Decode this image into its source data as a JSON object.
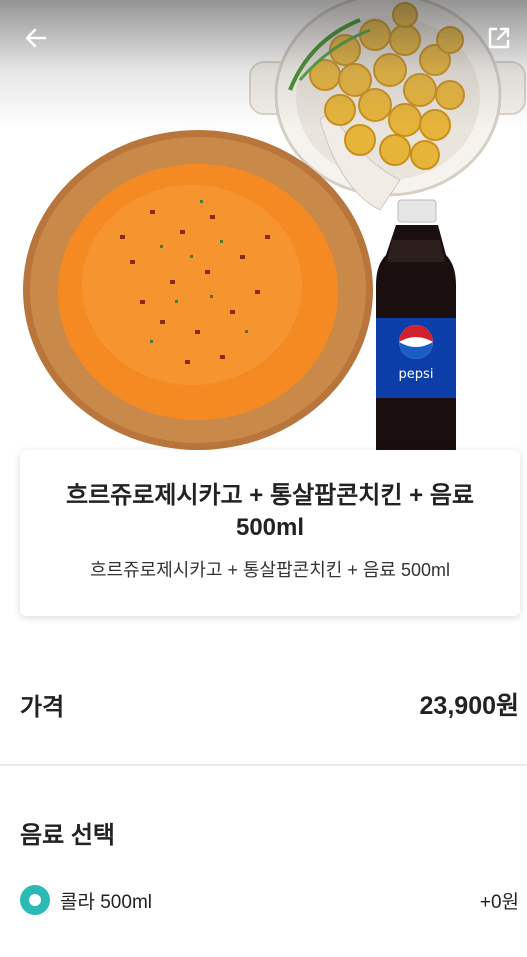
{
  "product": {
    "title": "흐르쥬로제시카고 + 통살팝콘치킨 + 음료 500ml",
    "description": "흐르쥬로제시카고 + 통살팝콘치킨 + 음료 500ml",
    "bottle_brand": "pepsi",
    "images": [
      "pizza-image",
      "popcorn-chicken-image",
      "pepsi-bottle-image"
    ]
  },
  "price": {
    "label": "가격",
    "value": "23,900원"
  },
  "drink_section": {
    "title": "음료 선택",
    "options": [
      {
        "label": "콜라 500ml",
        "price": "+0원",
        "selected": true
      }
    ]
  },
  "icons": {
    "back": "arrow-left-icon",
    "share": "external-link-icon",
    "radio": "radio-selected-icon"
  },
  "colors": {
    "accent": "#2ab9b5",
    "text": "#222222"
  }
}
